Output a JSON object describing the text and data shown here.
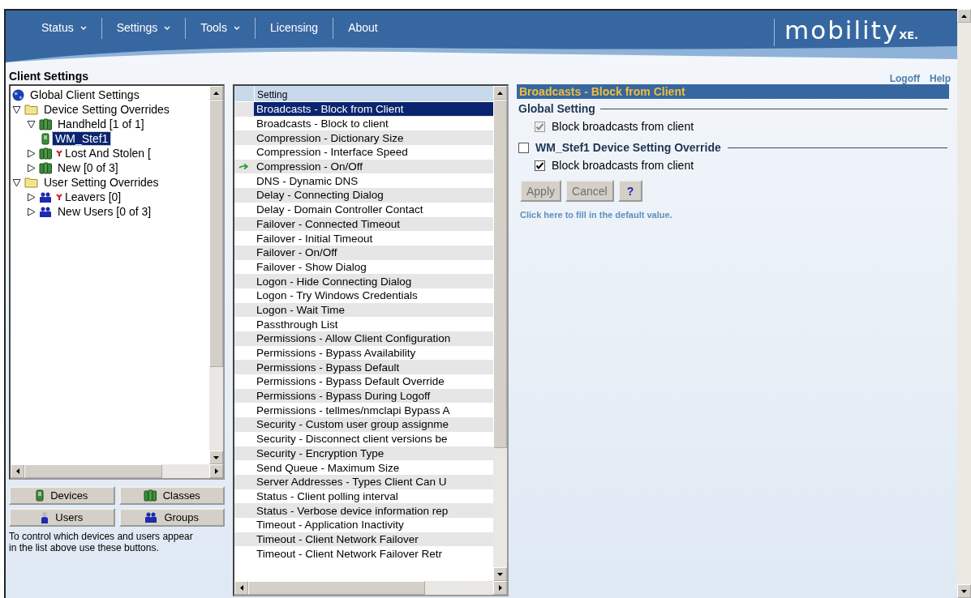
{
  "nav": [
    {
      "label": "Status",
      "dropdown": true
    },
    {
      "label": "Settings",
      "dropdown": true
    },
    {
      "label": "Tools",
      "dropdown": true
    },
    {
      "label": "Licensing",
      "dropdown": false
    },
    {
      "label": "About",
      "dropdown": false
    }
  ],
  "logo": {
    "name": "mobility",
    "suffix": "XE."
  },
  "page_title": "Client Settings",
  "top_links": [
    "Logoff",
    "Help"
  ],
  "tree": [
    {
      "label": "Global Client Settings",
      "kind": "globe",
      "flagged": false,
      "selected": false
    },
    {
      "label": "Device Setting Overrides",
      "kind": "folder",
      "flagged": false,
      "selected": false,
      "expanded": true,
      "children": [
        {
          "label": "Handheld  [1 of 1]",
          "kind": "device_class",
          "flagged": false,
          "selected": false,
          "expanded": true,
          "children": [
            {
              "label": "WM_Stef1",
              "kind": "device",
              "flagged": false,
              "selected": true
            }
          ]
        },
        {
          "label": "Lost And Stolen  [",
          "kind": "device_class",
          "flagged": true,
          "selected": false,
          "expanded": false
        },
        {
          "label": "New  [0 of 3]",
          "kind": "device_class",
          "flagged": false,
          "selected": false,
          "expanded": false
        }
      ]
    },
    {
      "label": "User Setting Overrides",
      "kind": "folder",
      "flagged": false,
      "selected": false,
      "expanded": true,
      "children": [
        {
          "label": "Leavers  [0]",
          "kind": "user_group",
          "flagged": true,
          "selected": false,
          "expanded": false
        },
        {
          "label": "New Users  [0 of 3]",
          "kind": "user_group",
          "flagged": false,
          "selected": false,
          "expanded": false
        }
      ]
    }
  ],
  "filter_buttons": [
    {
      "label": "Devices",
      "kind": "device"
    },
    {
      "label": "Classes",
      "kind": "device_class"
    },
    {
      "label": "Users",
      "kind": "user"
    },
    {
      "label": "Groups",
      "kind": "user_group"
    }
  ],
  "help_text": "To control which devices and users appear in the list above use these buttons.",
  "settings_list": {
    "column": "Setting",
    "rows": [
      {
        "label": "Broadcasts - Block from Client",
        "selected": true,
        "overridden": false
      },
      {
        "label": "Broadcasts - Block to client",
        "selected": false,
        "overridden": false
      },
      {
        "label": "Compression - Dictionary Size",
        "selected": false,
        "overridden": false
      },
      {
        "label": "Compression - Interface Speed",
        "selected": false,
        "overridden": false
      },
      {
        "label": "Compression - On/Off",
        "selected": false,
        "overridden": true
      },
      {
        "label": "DNS - Dynamic DNS",
        "selected": false,
        "overridden": false
      },
      {
        "label": "Delay - Connecting Dialog",
        "selected": false,
        "overridden": false
      },
      {
        "label": "Delay - Domain Controller Contact",
        "selected": false,
        "overridden": false
      },
      {
        "label": "Failover - Connected Timeout",
        "selected": false,
        "overridden": false
      },
      {
        "label": "Failover - Initial Timeout",
        "selected": false,
        "overridden": false
      },
      {
        "label": "Failover - On/Off",
        "selected": false,
        "overridden": false
      },
      {
        "label": "Failover - Show Dialog",
        "selected": false,
        "overridden": false
      },
      {
        "label": "Logon - Hide Connecting Dialog",
        "selected": false,
        "overridden": false
      },
      {
        "label": "Logon - Try Windows Credentials",
        "selected": false,
        "overridden": false
      },
      {
        "label": "Logon - Wait Time",
        "selected": false,
        "overridden": false
      },
      {
        "label": "Passthrough List",
        "selected": false,
        "overridden": false
      },
      {
        "label": "Permissions - Allow Client Configuration",
        "selected": false,
        "overridden": false
      },
      {
        "label": "Permissions - Bypass Availability",
        "selected": false,
        "overridden": false
      },
      {
        "label": "Permissions - Bypass Default",
        "selected": false,
        "overridden": false
      },
      {
        "label": "Permissions - Bypass Default Override",
        "selected": false,
        "overridden": false
      },
      {
        "label": "Permissions - Bypass During Logoff",
        "selected": false,
        "overridden": false
      },
      {
        "label": "Permissions - tellmes/nmclapi Bypass A",
        "selected": false,
        "overridden": false
      },
      {
        "label": "Security - Custom user group assignme",
        "selected": false,
        "overridden": false
      },
      {
        "label": "Security - Disconnect client versions be",
        "selected": false,
        "overridden": false
      },
      {
        "label": "Security - Encryption Type",
        "selected": false,
        "overridden": false
      },
      {
        "label": "Send Queue - Maximum Size",
        "selected": false,
        "overridden": false
      },
      {
        "label": "Server Addresses - Types Client Can U",
        "selected": false,
        "overridden": false
      },
      {
        "label": "Status - Client polling interval",
        "selected": false,
        "overridden": false
      },
      {
        "label": "Status - Verbose device information rep",
        "selected": false,
        "overridden": false
      },
      {
        "label": "Timeout - Application Inactivity",
        "selected": false,
        "overridden": false
      },
      {
        "label": "Timeout - Client Network Failover",
        "selected": false,
        "overridden": false
      },
      {
        "label": "Timeout - Client Network Failover Retr",
        "selected": false,
        "overridden": false
      }
    ]
  },
  "detail": {
    "header": "Broadcasts - Block from Client",
    "global_section": {
      "title": "Global Setting",
      "option": {
        "label": "Block broadcasts from client",
        "checked": true,
        "disabled": true
      }
    },
    "override_section": {
      "title": "WM_Stef1 Device Setting Override",
      "checked": false,
      "option": {
        "label": "Block broadcasts from client",
        "checked": true,
        "disabled": false
      }
    },
    "buttons": [
      {
        "label": "Apply",
        "disabled": true
      },
      {
        "label": "Cancel",
        "disabled": true
      },
      {
        "label": "?",
        "disabled": false
      }
    ],
    "default_link": "Click here to fill in the default value."
  }
}
